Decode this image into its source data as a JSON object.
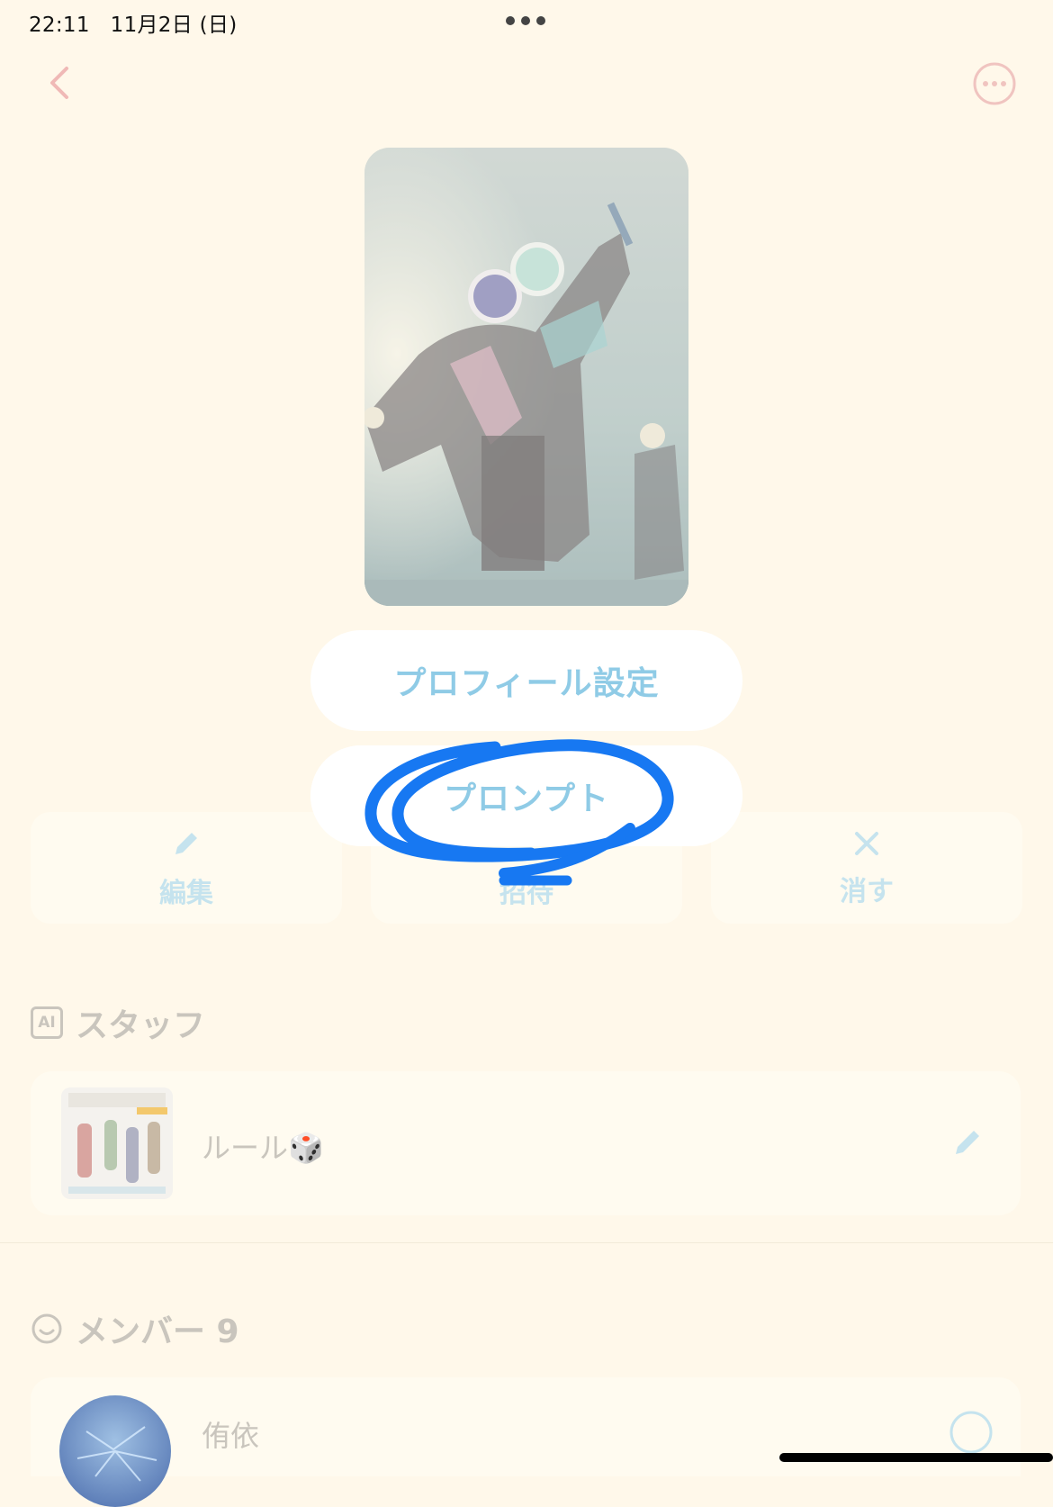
{
  "status_bar": {
    "time": "22:11",
    "date": "11月2日 (日)"
  },
  "icons": {
    "back": "chevron-left-icon",
    "more": "ellipsis-circle-icon",
    "edit": "pencil-icon",
    "delete": "close-icon",
    "ai": "ai-badge-icon",
    "member": "smile-icon"
  },
  "menu": {
    "profile_label": "プロフィール設定",
    "prompt_label": "プロンプト"
  },
  "actions": {
    "edit_label": "編集",
    "invite_label": "招待",
    "delete_label": "消す"
  },
  "staff": {
    "title": "スタッフ",
    "ai_badge": "AI",
    "items": [
      {
        "name": "ルール🎲"
      }
    ]
  },
  "members": {
    "title": "メンバー 9",
    "items": [
      {
        "name": "侑依"
      }
    ]
  },
  "colors": {
    "background": "#fff8ea",
    "accent": "#8fcbe6",
    "back_icon": "#f0b9b6",
    "annotation": "#1778f2"
  }
}
